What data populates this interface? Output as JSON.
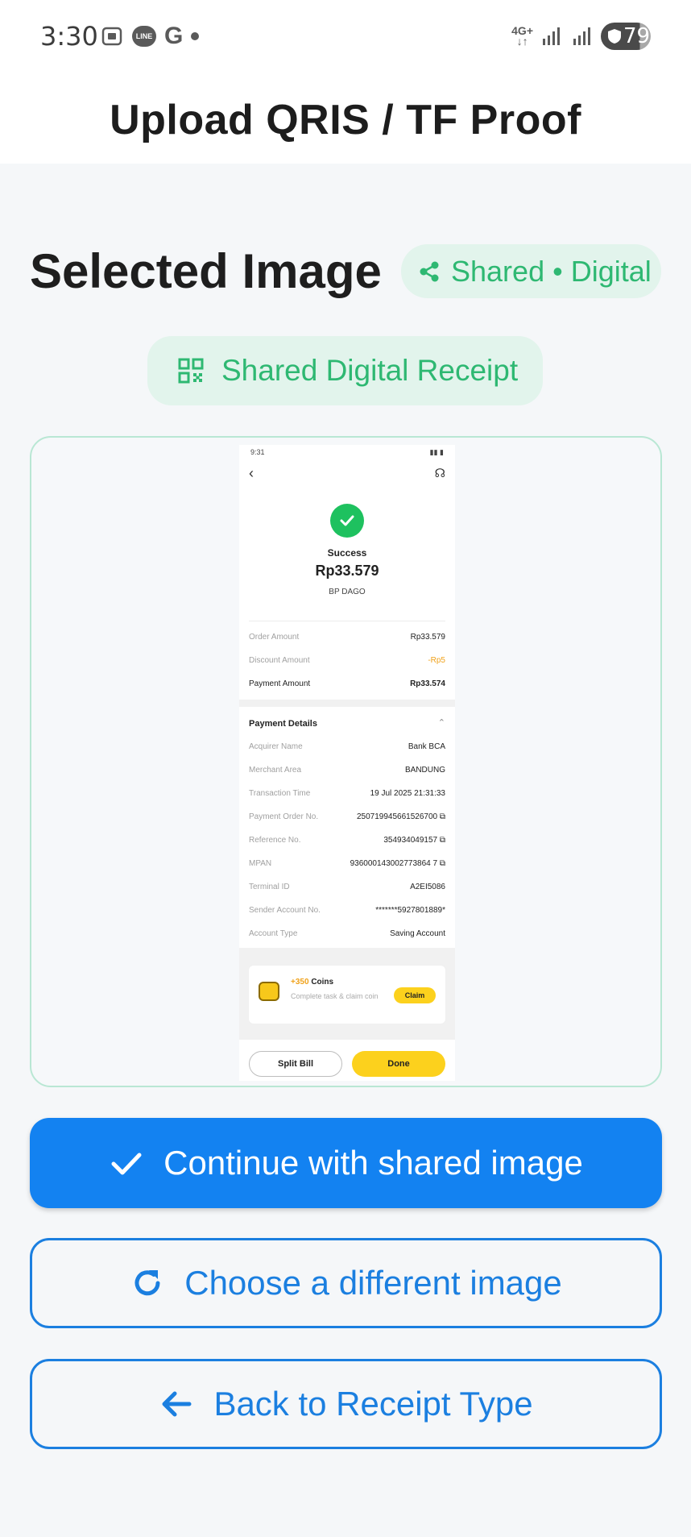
{
  "status_bar": {
    "time": "3:30",
    "line_badge": "LINE",
    "g_icon": "G",
    "network": "4G+",
    "battery": "79",
    "icons": [
      "screenshot-icon",
      "line-icon",
      "google-icon",
      "dot-icon",
      "network-4g-icon",
      "signal-icon",
      "signal-icon",
      "battery-icon"
    ]
  },
  "app_bar": {
    "title": "Upload QRIS / TF Proof"
  },
  "section": {
    "title": "Selected Image",
    "chip_shared": "Shared • Digital",
    "chip_receipt": "Shared Digital Receipt"
  },
  "receipt_preview": {
    "status_time": "9:31",
    "status": "Success",
    "amount": "Rp33.579",
    "merchant": "BP DAGO",
    "summary": [
      {
        "label": "Order Amount",
        "value": "Rp33.579"
      },
      {
        "label": "Discount Amount",
        "value": "-Rp5"
      },
      {
        "label": "Payment Amount",
        "value": "Rp33.574"
      }
    ],
    "details_title": "Payment Details",
    "details": [
      {
        "label": "Acquirer Name",
        "value": "Bank BCA"
      },
      {
        "label": "Merchant Area",
        "value": "BANDUNG"
      },
      {
        "label": "Transaction Time",
        "value": "19 Jul 2025 21:31:33"
      },
      {
        "label": "Payment Order No.",
        "value": "250719945661526700 ⧉"
      },
      {
        "label": "Reference No.",
        "value": "354934049157 ⧉"
      },
      {
        "label": "MPAN",
        "value": "936000143002773864 7 ⧉"
      },
      {
        "label": "Terminal ID",
        "value": "A2EI5086"
      },
      {
        "label": "Sender Account No.",
        "value": "*******5927801889*"
      },
      {
        "label": "Account Type",
        "value": "Saving Account"
      }
    ],
    "coins_plus": "+350",
    "coins_label": "Coins",
    "coins_sub": "Complete task & claim coin",
    "claim": "Claim",
    "split_bill": "Split Bill",
    "done": "Done"
  },
  "actions": {
    "continue": "Continue with shared image",
    "choose": "Choose a different image",
    "back": "Back to Receipt Type"
  },
  "colors": {
    "primary": "#1382f1",
    "green": "#2eb872",
    "green_bg": "#e2f4ec",
    "outline": "#1b7fe0"
  }
}
